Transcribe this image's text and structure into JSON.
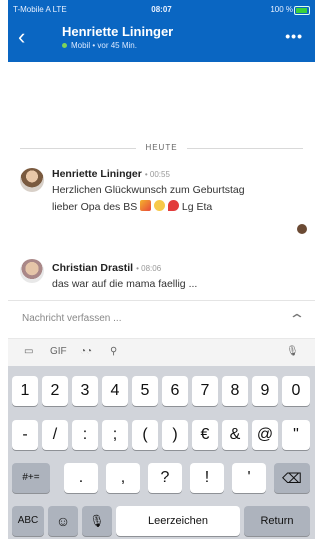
{
  "status": {
    "carrier": "T-Mobile A  LTE",
    "time": "08:07",
    "battery": "100 %"
  },
  "header": {
    "back": "‹",
    "title": "Henriette Lininger",
    "subtitle": "Mobil • vor 45 Min.",
    "more": "•••"
  },
  "divider": "HEUTE",
  "messages": [
    {
      "author": "Henriette Lininger",
      "time": "• 00:55",
      "line1": "Herzlichen Glückwunsch zum Geburtstag",
      "line2": "lieber Opa des BS",
      "line2_tail": "Lg Eta"
    },
    {
      "author": "Christian Drastil",
      "time": "• 08:06",
      "line1": "das war auf die mama faellig ..."
    }
  ],
  "compose": {
    "placeholder": "Nachricht verfassen ...",
    "expand": "⌃"
  },
  "tools": [
    "▭",
    "GIF",
    "◔◔",
    "⚲",
    "🎙"
  ],
  "keyboard": {
    "row1": [
      "1",
      "2",
      "3",
      "4",
      "5",
      "6",
      "7",
      "8",
      "9",
      "0"
    ],
    "row2": [
      "-",
      "/",
      ":",
      ";",
      "(",
      ")",
      "€",
      "&",
      "@",
      "\""
    ],
    "row3": [
      "#+=",
      ".",
      ",",
      "?",
      "!",
      "'",
      "⌫"
    ],
    "row4": [
      "ABC",
      "☺",
      "🎙",
      "Leerzeichen",
      "Return"
    ]
  }
}
